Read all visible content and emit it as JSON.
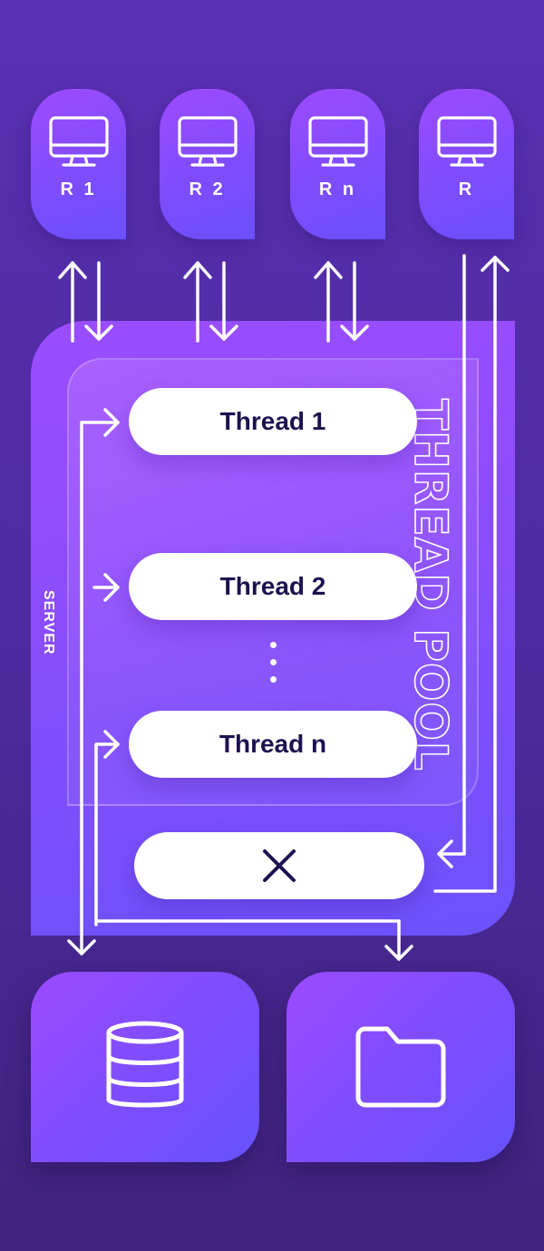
{
  "clients": [
    {
      "label": "R 1",
      "icon": "monitor-icon"
    },
    {
      "label": "R 2",
      "icon": "monitor-icon"
    },
    {
      "label": "R n",
      "icon": "monitor-icon"
    },
    {
      "label": "R",
      "icon": "monitor-icon"
    }
  ],
  "server": {
    "label": "SERVER",
    "pool_label": "THREAD POOL",
    "threads": [
      "Thread 1",
      "Thread 2",
      "Thread n"
    ],
    "ellipsis_icon": "vertical-dots-icon",
    "reject_icon": "close-x-icon"
  },
  "storage": [
    {
      "icon": "database-icon"
    },
    {
      "icon": "folder-icon"
    }
  ],
  "colors": {
    "background": "#5a30b4",
    "card_gradient_start": "#9d4bff",
    "card_gradient_end": "#6a50fb",
    "thread_text": "#1e1150",
    "line": "#ffffff"
  }
}
